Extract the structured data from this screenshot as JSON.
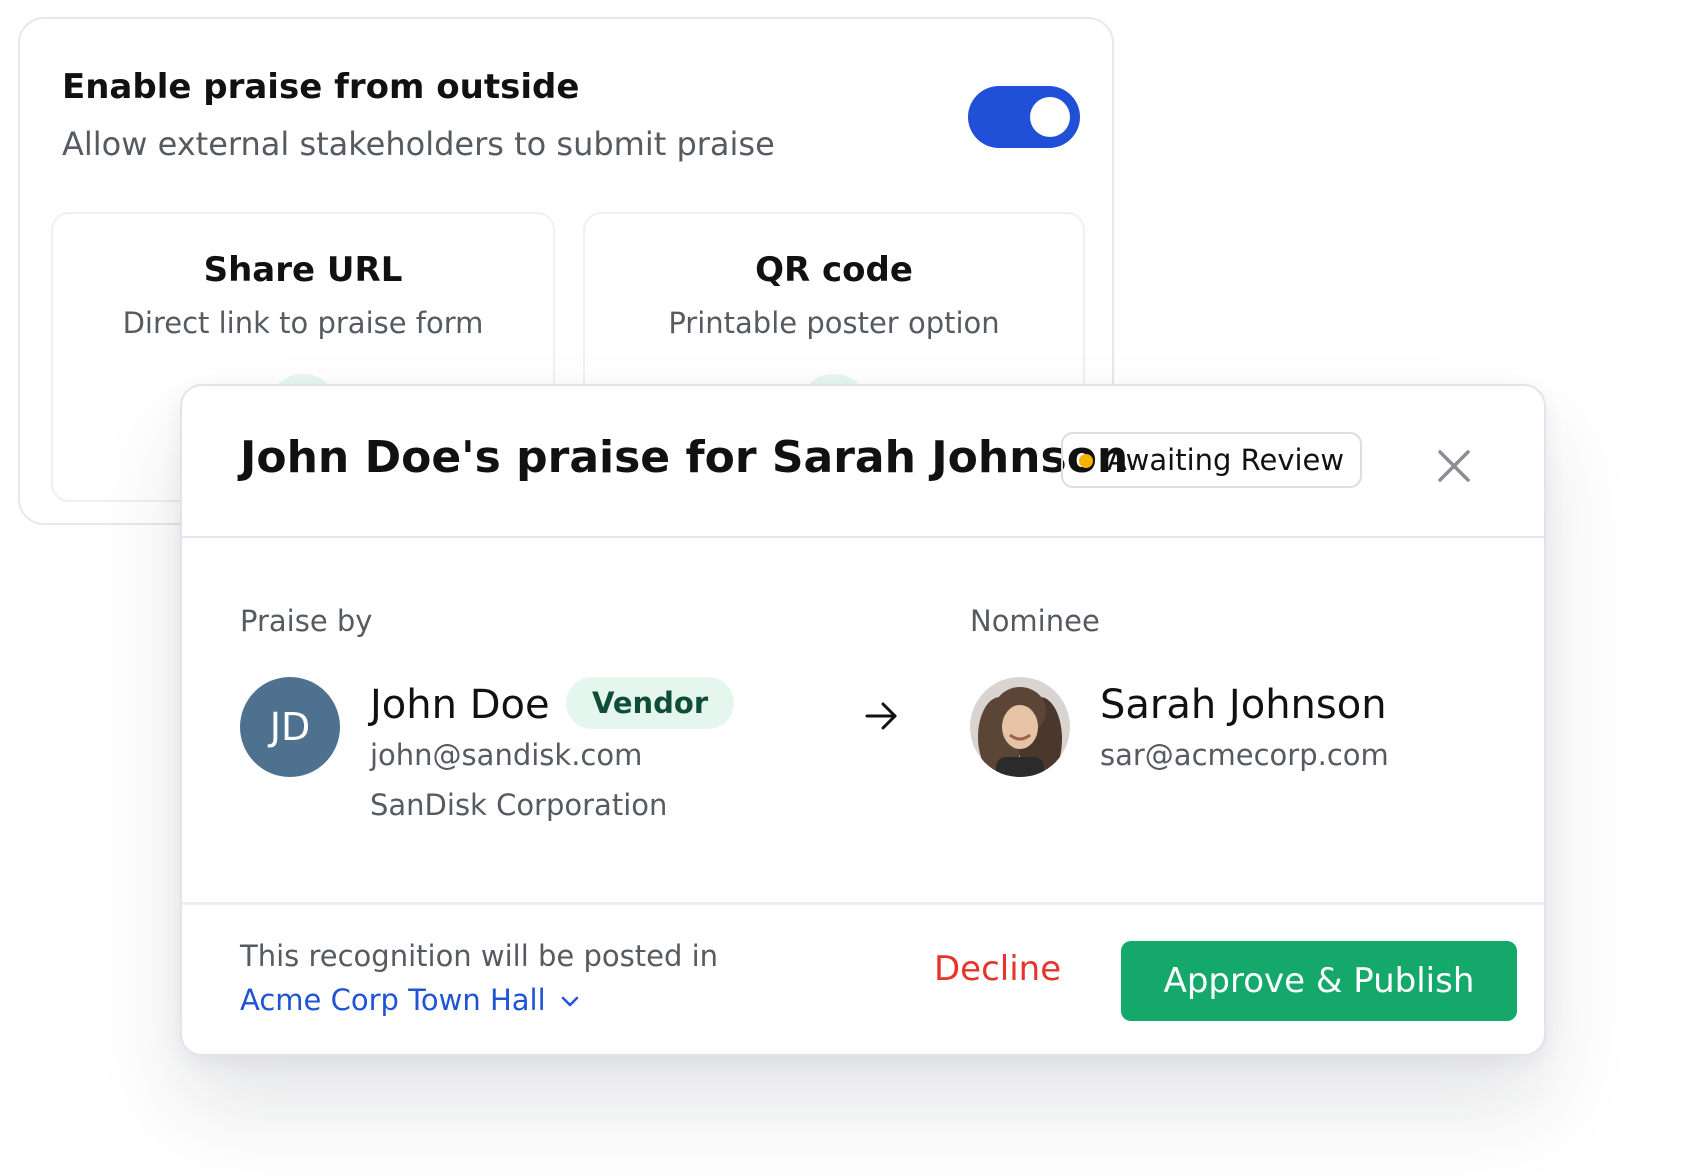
{
  "settings": {
    "title": "Enable praise from outside",
    "description": "Allow external stakeholders to submit praise",
    "toggle_on": true,
    "toggle_color": "#2050d8",
    "options": [
      {
        "title": "Share URL",
        "description": "Direct link to praise form"
      },
      {
        "title": "QR code",
        "description": "Printable poster option"
      }
    ]
  },
  "modal": {
    "title": "John Doe's praise for Sarah Johnson",
    "status": "Awaiting Review",
    "status_color": "#f5b300",
    "close_icon": "close-icon",
    "praise_by_label": "Praise by",
    "nominee_label": "Nominee",
    "giver": {
      "initials": "JD",
      "name": "John Doe",
      "badge": "Vendor",
      "email": "john@sandisk.com",
      "company": "SanDisk Corporation",
      "avatar_color": "#4f7190"
    },
    "arrow_icon": "arrow-right-icon",
    "nominee": {
      "name": "Sarah Johnson",
      "email": "sar@acmecorp.com",
      "avatar": "photo-avatar"
    },
    "footer": {
      "note": "This recognition will be posted in",
      "channel": "Acme Corp Town Hall",
      "channel_icon": "chevron-down-icon",
      "decline_label": "Decline",
      "approve_label": "Approve & Publish",
      "decline_color": "#e5352b",
      "approve_color": "#14a86b",
      "link_color": "#2054d6"
    }
  }
}
